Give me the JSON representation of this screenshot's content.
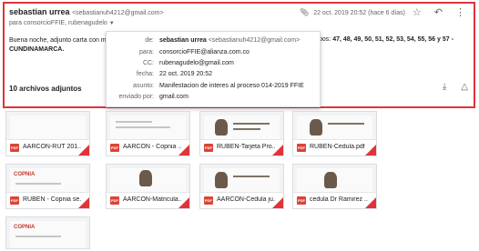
{
  "header": {
    "sender_name": "sebastian urrea",
    "sender_email": "<sebastianuh4212@gmail.com>",
    "to_line": "para consorcioFFIE, rubenagudelo",
    "date": "22 oct. 2019 20:52 (hace 6 días)",
    "icons": [
      "paperclip-icon",
      "star-icon",
      "reply-icon",
      "more-vert-icon"
    ]
  },
  "body": {
    "line1": "Buena noche, adjunto carta con m",
    "line2": "CUNDINAMARCA.",
    "right_prefix": "pos:",
    "right_values": "47, 48, 49, 50, 51, 52, 53, 54, 55, 56 y 57 -"
  },
  "details": {
    "de": {
      "label": "de:",
      "name": "sebastian urrea",
      "email": "<sebastianuh4212@gmail.com>"
    },
    "para": {
      "label": "para:",
      "value": "consorcioFFIE@alianza.com.co"
    },
    "cc": {
      "label": "CC:",
      "value": "rubenagudelo@gmail.com"
    },
    "fecha": {
      "label": "fecha:",
      "value": "22 oct. 2019 20:52"
    },
    "asunto": {
      "label": "asunto:",
      "value": "Manifestacion de interes al proceso 014-2019 FFIE"
    },
    "enviado": {
      "label": "enviado por:",
      "value": "gmail.com"
    }
  },
  "attachments": {
    "count_label": "10 archivos adjuntos",
    "icons": [
      "download-icon",
      "drive-icon"
    ],
    "files": [
      {
        "name": "AARCON-RUT 201...",
        "type": "PDF"
      },
      {
        "name": "AARCON - Copnia ...",
        "type": "PDF"
      },
      {
        "name": "RUBEN-Tarjeta Pro...",
        "type": "PDF"
      },
      {
        "name": "RUBEN-Cedula.pdf",
        "type": "PDF"
      },
      {
        "name": "RUBEN - Copnia se...",
        "type": "PDF"
      },
      {
        "name": "AARCON-Matricula...",
        "type": "PDF"
      },
      {
        "name": "AARCON-Cedula ju...",
        "type": "PDF"
      },
      {
        "name": "cedula Dr Ramirez ...",
        "type": "PDF"
      },
      {
        "name": "",
        "type": ""
      }
    ],
    "logo_text": "COPNIA"
  },
  "colors": {
    "highlight": "#e0343a",
    "pdf": "#db4437"
  }
}
